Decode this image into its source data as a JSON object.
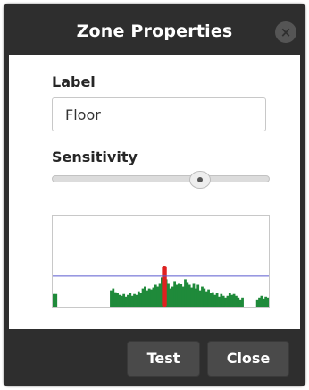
{
  "dialog": {
    "title": "Zone Properties",
    "close_glyph": "×"
  },
  "fields": {
    "label_heading": "Label",
    "label_value": "Floor",
    "sensitivity_heading": "Sensitivity",
    "sensitivity_level": 0.68
  },
  "activity_graph": {
    "threshold": 0.34,
    "colors": {
      "activity": "#1f8a3a",
      "peak": "#e02020",
      "threshold": "#5a5acf"
    },
    "series": [
      0.14,
      0.14,
      0.0,
      0.0,
      0.0,
      0.0,
      0.0,
      0.0,
      0.0,
      0.0,
      0.0,
      0.0,
      0.0,
      0.0,
      0.0,
      0.0,
      0.0,
      0.0,
      0.0,
      0.0,
      0.0,
      0.0,
      0.0,
      0.0,
      0.0,
      0.0,
      0.0,
      0.18,
      0.2,
      0.16,
      0.15,
      0.13,
      0.12,
      0.14,
      0.11,
      0.13,
      0.15,
      0.12,
      0.14,
      0.13,
      0.17,
      0.15,
      0.2,
      0.22,
      0.18,
      0.2,
      0.19,
      0.21,
      0.24,
      0.22,
      0.26,
      0.32,
      0.45,
      0.3,
      0.26,
      0.2,
      0.22,
      0.28,
      0.24,
      0.26,
      0.25,
      0.22,
      0.3,
      0.27,
      0.24,
      0.21,
      0.26,
      0.2,
      0.24,
      0.18,
      0.22,
      0.2,
      0.17,
      0.19,
      0.15,
      0.16,
      0.13,
      0.15,
      0.11,
      0.14,
      0.12,
      0.1,
      0.12,
      0.15,
      0.13,
      0.14,
      0.12,
      0.1,
      0.08,
      0.1,
      0.0,
      0.0,
      0.0,
      0.0,
      0.0,
      0.0,
      0.08,
      0.1,
      0.12,
      0.09,
      0.11,
      0.1
    ],
    "peak_series": [
      0.0,
      0.0,
      0.0,
      0.0,
      0.0,
      0.0,
      0.0,
      0.0,
      0.0,
      0.0,
      0.0,
      0.0,
      0.0,
      0.0,
      0.0,
      0.0,
      0.0,
      0.0,
      0.0,
      0.0,
      0.0,
      0.0,
      0.0,
      0.0,
      0.0,
      0.0,
      0.0,
      0.0,
      0.0,
      0.0,
      0.0,
      0.0,
      0.0,
      0.0,
      0.0,
      0.0,
      0.0,
      0.0,
      0.0,
      0.0,
      0.0,
      0.0,
      0.0,
      0.0,
      0.0,
      0.0,
      0.0,
      0.0,
      0.0,
      0.0,
      0.0,
      0.0,
      0.45,
      0.0,
      0.0,
      0.0,
      0.0,
      0.0,
      0.0,
      0.0,
      0.0,
      0.0,
      0.0,
      0.0,
      0.0,
      0.0,
      0.0,
      0.0,
      0.0,
      0.0,
      0.0,
      0.0,
      0.0,
      0.0,
      0.0,
      0.0,
      0.0,
      0.0,
      0.0,
      0.0,
      0.0,
      0.0,
      0.0,
      0.0,
      0.0,
      0.0,
      0.0,
      0.0,
      0.0,
      0.0,
      0.0,
      0.0,
      0.0,
      0.0,
      0.0,
      0.0,
      0.0,
      0.0,
      0.0,
      0.0,
      0.0,
      0.0
    ]
  },
  "buttons": {
    "test_label": "Test",
    "close_label": "Close"
  }
}
